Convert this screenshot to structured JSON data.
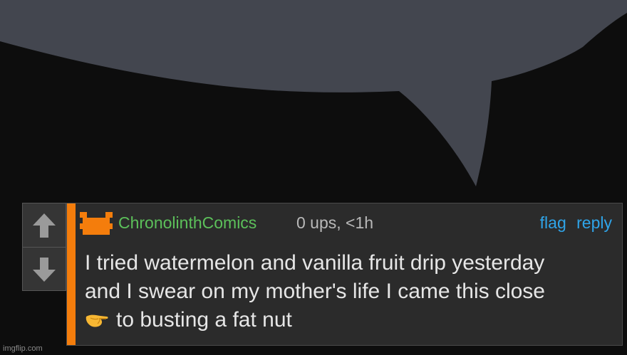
{
  "comment": {
    "username": "ChronolinthComics",
    "meta": "0 ups, <1h",
    "flag_label": "flag",
    "reply_label": "reply",
    "lines": [
      "I tried watermelon and vanilla fruit drip yesterday",
      "and I swear on my mother's life I came this close",
      "to busting a fat nut"
    ],
    "emoji_icon": "pinching-hand-emoji"
  },
  "votes": {
    "up_icon": "arrow-up-icon",
    "down_icon": "arrow-down-icon"
  },
  "watermark": "imgflip.com",
  "colors": {
    "accent": "#f47d0c",
    "username": "#5cc05a",
    "link": "#2fa4e8",
    "bubble": "#43464f"
  }
}
